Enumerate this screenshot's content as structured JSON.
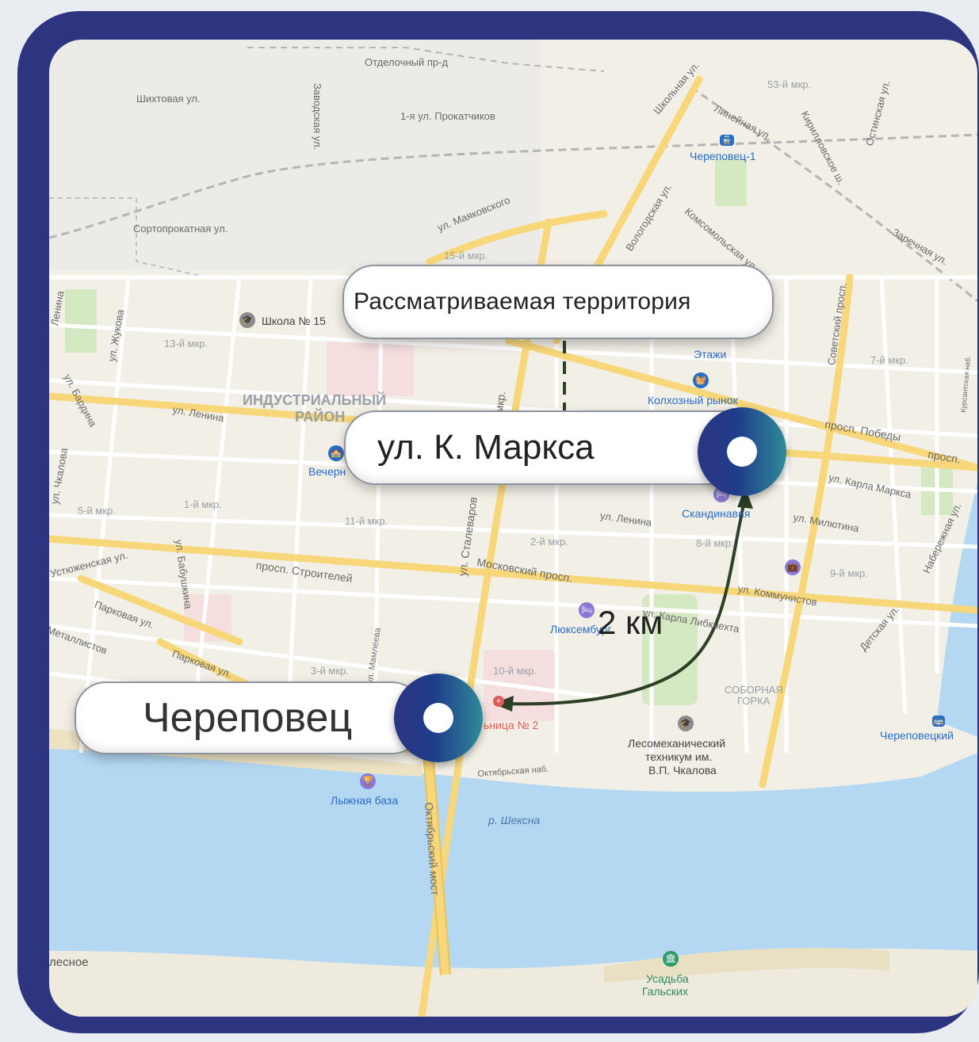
{
  "callouts": {
    "area": "Рассматриваемая  территория",
    "street": "ул. К. Маркса",
    "city": "Череповец"
  },
  "distance": "2 км",
  "map_labels": {
    "l01": "Отделочный пр-д",
    "l02": "Шихтовая ул.",
    "l03": "Заводская ул.",
    "l04": "1-я ул. Прокатчиков",
    "l05": "Школьная ул.",
    "l06": "Линейная ул.",
    "l07": "53-й мкр.",
    "l08": "Кирилловское ш.",
    "l09": "Остинская ул.",
    "l10": "Череповец-1",
    "l11": "ул. Маяковского",
    "l12": "Вологодская ул.",
    "l13": "Комсомольская ул.",
    "l14": "Заречная ул.",
    "l15": "Сортопрокатная ул.",
    "l16": "15-й мкр.",
    "l17": "Школа № 15",
    "l18": "Советский просп.",
    "l19": "ул. Жукова",
    "l20": "13-й мкр.",
    "l21": "Этажи",
    "l22": "7-й мкр.",
    "l23": "Курсантская наб.",
    "l24": "Колхозный рынок",
    "l25": "ул. Бардина",
    "l26": "Индустриальный",
    "l27": "район",
    "l28": "ул. Ленина",
    "l29": "Вечерн",
    "l30": "просп. Победы",
    "l31": "просп.",
    "l32": "ул. Карла Маркса",
    "l33": "ул. Чкалова",
    "l34": "Набережная ул.",
    "l35": "5-й мкр.",
    "l36": "1-й мкр.",
    "l37": "11-й мкр.",
    "l38": "ул. Сталеваров",
    "l39": "ул. Ленина",
    "l40": "Скандинавия",
    "l41": "ул. Милютина",
    "l42": "8-й мкр.",
    "l43": "2-й мкр.",
    "l44": "ул. Бабушкина",
    "l45": "Устюженская ул.",
    "l46": "просп. Строителей",
    "l47": "Московский просп.",
    "l48": "9-й мкр.",
    "l49": "ул. Коммунистов",
    "l50": "Детская ул.",
    "l51": "Парковая ул.",
    "l52": "ул. Карла Либкнехта",
    "l53": "Люксембург",
    "l54": "Металлистов",
    "l55": "Парковая ул.",
    "l56": "ул. Мамлеева",
    "l57": "3-й мкр.",
    "l58": "10-й мкр.",
    "l59": "Соборная",
    "l60": "горка",
    "l61": "ьница № 2",
    "l62": "Лесомеханический",
    "l63": "техникум им.",
    "l64": "В.П. Чкалова",
    "l65": "Череповецкий",
    "l66": "Октябрьская наб.",
    "l67": "Лыжная база",
    "l68": "Октябрьский мост",
    "l69": "р. Шексна",
    "l70": "лесное",
    "l71": "Усадьба",
    "l72": "Гальских",
    "l73": "Ленина",
    "l74": "мкр."
  },
  "colors": {
    "frame": "#2e3580",
    "land": "#f2efe6",
    "water": "#b4d8f2",
    "road_major": "#f7d77a",
    "route": "#2d3f25"
  },
  "icons": {
    "school": "graduation-cap-icon",
    "station": "train-icon",
    "shop": "basket-icon",
    "hotel": "bed-icon",
    "hospital": "cross-icon",
    "education": "college-icon",
    "ski": "trophy-icon",
    "museum": "museum-icon",
    "work": "briefcase-icon"
  }
}
